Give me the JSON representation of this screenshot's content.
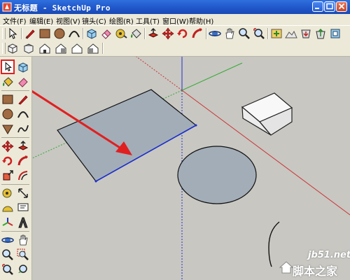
{
  "window": {
    "title": "无标题 - SketchUp Pro"
  },
  "menu": [
    "文件(F)",
    "编辑(E)",
    "视图(V)",
    "镜头(C)",
    "绘图(R)",
    "工具(T)",
    "窗口(W)",
    "帮助(H)"
  ],
  "icons": {
    "toolbar1": [
      "select-arrow-icon",
      "pencil-icon",
      "rectangle-icon",
      "circle-icon",
      "arc-icon",
      "make-component-icon",
      "eraser-icon",
      "tape-measure-icon",
      "paint-bucket-icon",
      "push-pull-icon",
      "move-icon",
      "rotate-icon",
      "follow-me-icon",
      "orbit-icon",
      "pan-icon",
      "zoom-icon",
      "zoom-extents-icon",
      "add-location-icon",
      "toggle-terrain-icon",
      "get-models-icon"
    ],
    "toolbar2": [
      "iso-view-icon",
      "top-view-icon",
      "front-view-icon",
      "right-view-icon",
      "back-view-icon",
      "left-view-icon"
    ],
    "left": [
      "select-icon",
      "component-icon",
      "paint-icon",
      "eraser-icon",
      "rectangle-icon",
      "line-icon",
      "circle-icon",
      "arc-icon",
      "polygon-icon",
      "freehand-icon",
      "move-icon",
      "push-pull-icon",
      "rotate-icon",
      "follow-me-icon",
      "scale-icon",
      "offset-icon",
      "tape-measure-icon",
      "dimension-icon",
      "protractor-icon",
      "text-icon",
      "axes-icon",
      "3d-text-icon",
      "orbit-icon",
      "pan-icon",
      "zoom-icon",
      "zoom-window-icon",
      "zoom-extents-icon",
      "previous-view-icon"
    ]
  },
  "colors": {
    "selection_highlight": "#e02020",
    "face": "#a3adb8",
    "axis_red": "#cc3333",
    "axis_green": "#33aa33",
    "axis_blue": "#2233cc"
  },
  "watermark": {
    "site": "jb51.net",
    "name": "脚本之家"
  }
}
